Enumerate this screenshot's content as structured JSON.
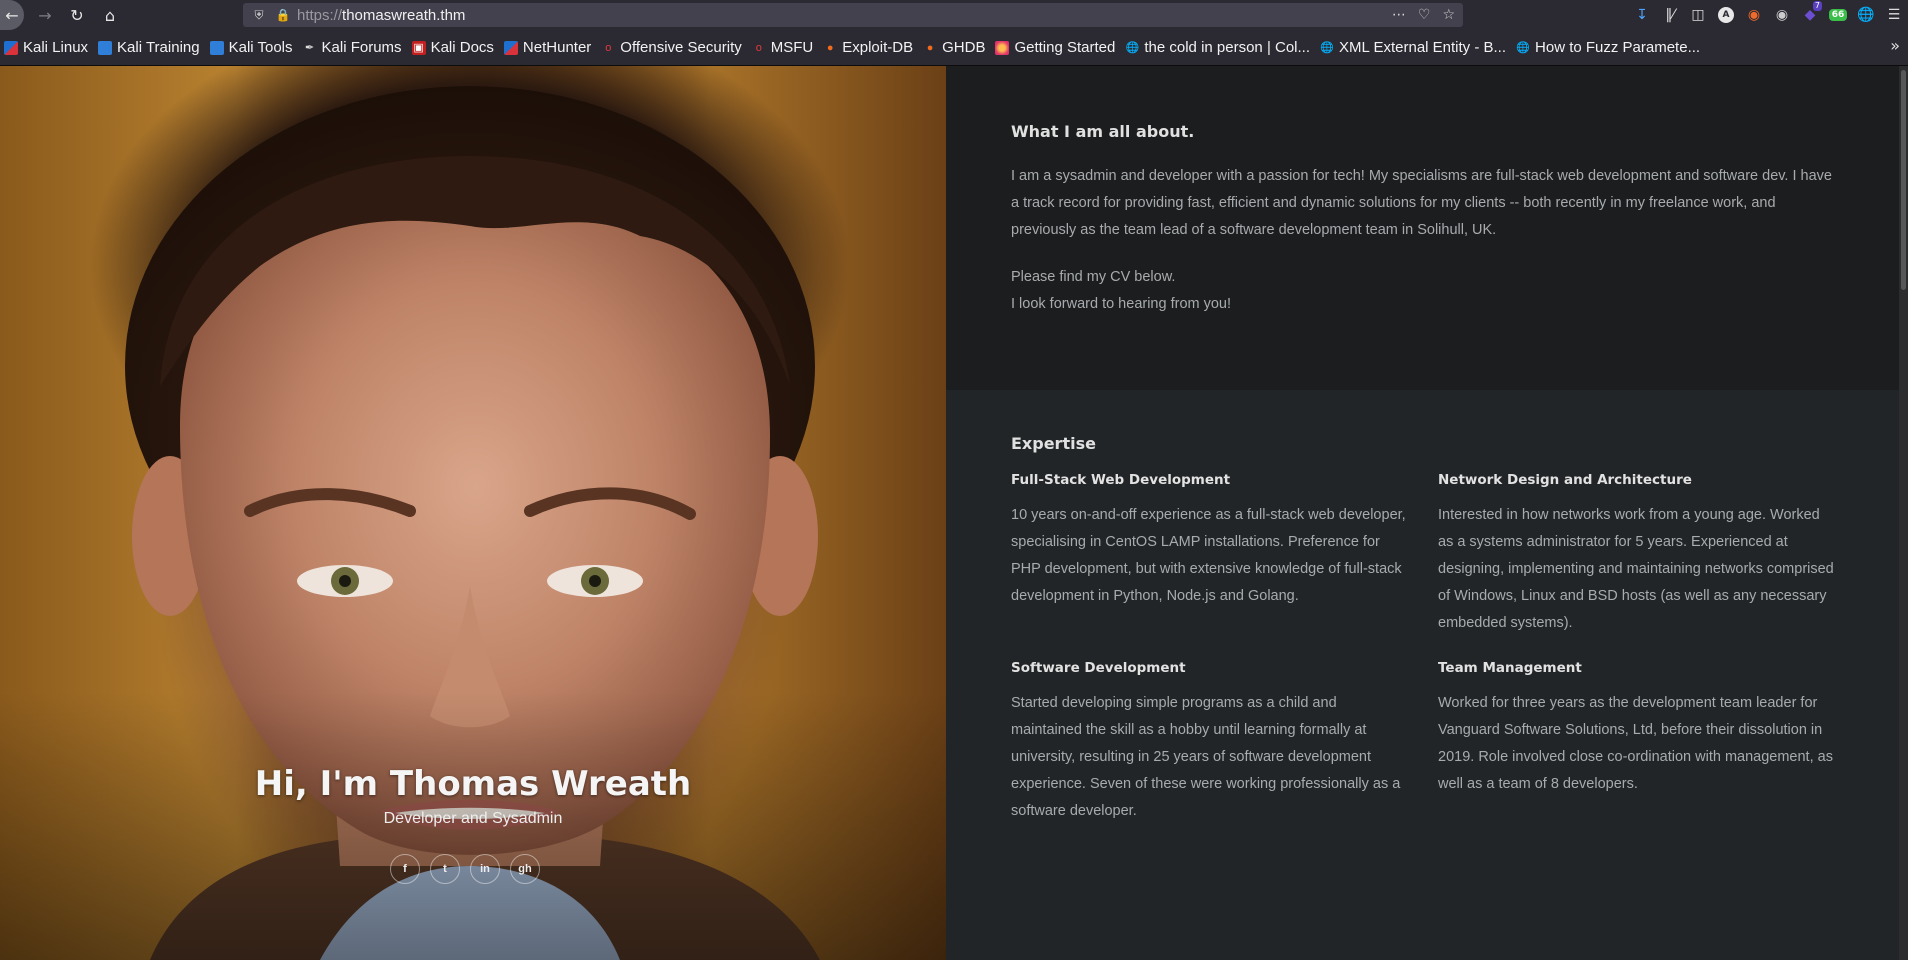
{
  "browser": {
    "url_scheme": "https://",
    "url_host": "thomaswreath.thm",
    "ext_badge": "7",
    "ext_label": "A",
    "ext_green": "66",
    "bookmarks": [
      {
        "label": "Kali Linux",
        "icon": "kali-icon"
      },
      {
        "label": "Kali Training",
        "icon": "kali-training-icon"
      },
      {
        "label": "Kali Tools",
        "icon": "kali-tools-icon"
      },
      {
        "label": "Kali Forums",
        "icon": "kali-forums-icon"
      },
      {
        "label": "Kali Docs",
        "icon": "kali-docs-icon"
      },
      {
        "label": "NetHunter",
        "icon": "nethunter-icon"
      },
      {
        "label": "Offensive Security",
        "icon": "offsec-icon"
      },
      {
        "label": "MSFU",
        "icon": "msfu-icon"
      },
      {
        "label": "Exploit-DB",
        "icon": "exploitdb-icon"
      },
      {
        "label": "GHDB",
        "icon": "ghdb-icon"
      },
      {
        "label": "Getting Started",
        "icon": "firefox-icon"
      },
      {
        "label": "the cold in person | Col...",
        "icon": "globe-icon"
      },
      {
        "label": "XML External Entity - B...",
        "icon": "globe-icon"
      },
      {
        "label": "How to Fuzz Paramete...",
        "icon": "globe-icon"
      }
    ]
  },
  "hero": {
    "title": "Hi, I'm Thomas Wreath",
    "subtitle": "Developer and Sysadmin",
    "social": [
      {
        "name": "facebook",
        "glyph": "f"
      },
      {
        "name": "twitter",
        "glyph": "t"
      },
      {
        "name": "linkedin",
        "glyph": "in"
      },
      {
        "name": "github",
        "glyph": "gh"
      }
    ]
  },
  "about": {
    "heading": "What I am all about.",
    "paragraph1": "I am a sysadmin and developer with a passion for tech! My specialisms are full-stack web development and software dev. I have a track record for providing fast, efficient and dynamic solutions for my clients -- both recently in my freelance work, and previously as the team lead of a software development team in Solihull, UK.",
    "paragraph2_line1": "Please find my CV below.",
    "paragraph2_line2": "I look forward to hearing from you!"
  },
  "expertise": {
    "heading": "Expertise",
    "items": [
      {
        "title": "Full-Stack Web Development",
        "text": "10 years on-and-off experience as a full-stack web developer, specialising in CentOS LAMP installations. Preference for PHP development, but with extensive knowledge of full-stack development in Python, Node.js and Golang."
      },
      {
        "title": "Network Design and Architecture",
        "text": "Interested in how networks work from a young age. Worked as a systems administrator for 5 years. Experienced at designing, implementing and maintaining networks comprised of Windows, Linux and BSD hosts (as well as any necessary embedded systems)."
      },
      {
        "title": "Software Development",
        "text": "Started developing simple programs as a child and maintained the skill as a hobby until learning formally at university, resulting in 25 years of software development experience. Seven of these were working professionally as a software developer."
      },
      {
        "title": "Team Management",
        "text": "Worked for three years as the development team leader for Vanguard Software Solutions, Ltd, before their dissolution in 2019. Role involved close co-ordination with management, as well as a team of 8 developers."
      }
    ]
  }
}
